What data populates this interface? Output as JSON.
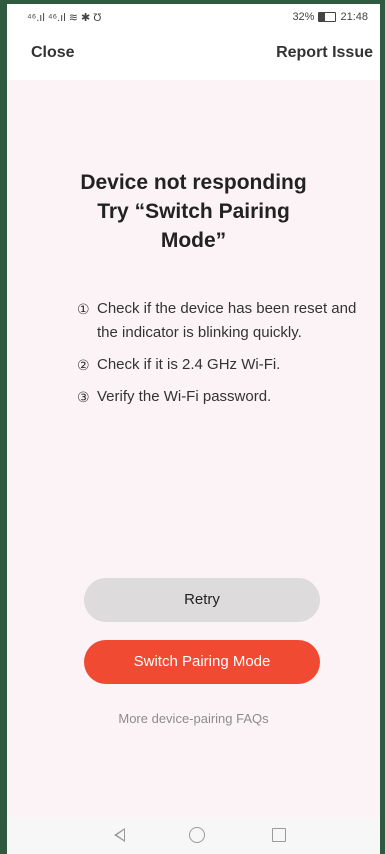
{
  "status_bar": {
    "signal_text": "⁴⁶.ıl ⁴⁶.ıl ≋ ✱ Ʊ",
    "battery_percent": "32%",
    "battery_level": 0.32,
    "time": "21:48"
  },
  "header": {
    "close_label": "Close",
    "report_label": "Report Issue"
  },
  "main": {
    "title_line1": "Device not responding",
    "title_line2": "Try “Switch Pairing",
    "title_line3": "Mode”",
    "steps": [
      {
        "num": "①",
        "text": "Check if the device has been reset and the indicator is blinking quickly."
      },
      {
        "num": "②",
        "text": "Check if it is 2.4 GHz Wi-Fi."
      },
      {
        "num": "③",
        "text": "Verify the Wi-Fi password."
      }
    ],
    "retry_label": "Retry",
    "switch_label": "Switch Pairing Mode",
    "faq_label": "More device-pairing FAQs"
  },
  "colors": {
    "accent": "#f04a33",
    "content_bg": "#fcf3f6",
    "frame": "#2e5a3f"
  },
  "nav": {
    "back_icon": "back-triangle-icon",
    "home_icon": "home-circle-icon",
    "recent_icon": "recent-square-icon"
  }
}
